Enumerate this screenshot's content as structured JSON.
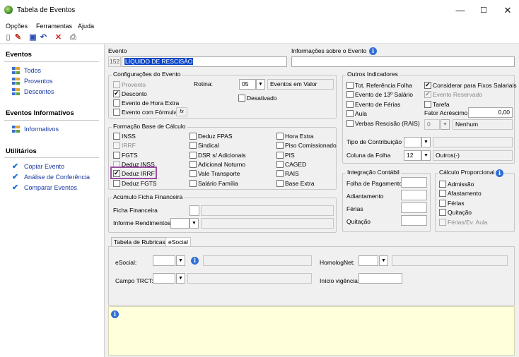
{
  "window": {
    "title": "Tabela de Eventos",
    "min": "—",
    "max": "☐",
    "close": "✕"
  },
  "menu": [
    "Opções",
    "Ferramentas",
    "Ajuda"
  ],
  "sidebar": {
    "sec1": "Eventos",
    "items1": [
      "Todos",
      "Proventos",
      "Descontos"
    ],
    "sec2": "Eventos Informativos",
    "items2": [
      "Informativos"
    ],
    "sec3": "Utilitários",
    "items3": [
      "Copiar Evento",
      "Análise de Conferência",
      "Comparar Eventos"
    ]
  },
  "evento": {
    "label": "Evento",
    "code": "152",
    "name": "LÍQUIDO DE RESCISÃO"
  },
  "info_evento": {
    "label": "Informações sobre o Evento"
  },
  "config": {
    "title": "Configurações do Evento",
    "proventos": "Provento",
    "desconto": "Desconto",
    "hora_extra": "Evento de Hora Extra",
    "formula": "Evento com Fórmula",
    "fx": "fx",
    "rotina_label": "Rotina:",
    "rotina_code": "05",
    "rotina_desc": "Eventos em Valor",
    "desativado": "Desativado"
  },
  "formacao": {
    "title": "Formação Base de Cálculo",
    "col1": [
      "INSS",
      "IRRF",
      "FGTS",
      "Deduz INSS",
      "Deduz IRRF",
      "Deduz FGTS"
    ],
    "col2": [
      "Deduz FPAS",
      "Sindical",
      "DSR s/ Adicionais",
      "Adicional Noturno",
      "Vale Transporte",
      "Salário Família"
    ],
    "col3": [
      "Hora Extra",
      "Piso Comissionado",
      "PIS",
      "CAGED",
      "RAIS",
      "Base Extra"
    ]
  },
  "acumulo": {
    "title": "Acúmulo Ficha Financeira",
    "ficha": "Ficha Financeira",
    "informe": "Informe Rendimentos"
  },
  "outros": {
    "title": "Outros Indicadores",
    "tot_ref": "Tot. Referência Folha",
    "considerar": "Considerar para Fixos Salariais",
    "decimo": "Evento de 13º Salário",
    "reservado": "Evento Reservado",
    "ferias": "Evento de Férias",
    "tarefa": "Tarefa",
    "aula": "Aula",
    "fator_label": "Fator Acréscimo",
    "fator_value": "0,00",
    "verbas": "Verbas Rescisão (RAIS)",
    "verbas_code": "0",
    "verbas_desc": "Nenhum",
    "tipo_contrib": "Tipo de Contribuição",
    "coluna_folha": "Coluna da Folha",
    "coluna_code": "12",
    "coluna_desc": "Outros(-)"
  },
  "integracao": {
    "title": "Integração Contábil",
    "items": [
      "Folha de Pagamento",
      "Adiantamento",
      "Férias",
      "Quitação"
    ]
  },
  "calculo": {
    "title": "Cálculo Proporcional",
    "items": [
      "Admissão",
      "Afastamento",
      "Férias",
      "Quitação",
      "Férias/Ev. Aula"
    ]
  },
  "tabs": [
    "Tabela de Rubricas",
    "eSocial"
  ],
  "esocial": {
    "esocial_label": "eSocial:",
    "homolog_label": "HomologNet:",
    "trct_label": "Campo TRCT:",
    "inicio_label": "Início vigência:"
  },
  "colors": {
    "accent": "#1a3aa0",
    "highlight": "#0a46c8",
    "note_bg": "#ffffdc",
    "mark": "#9b4ea0"
  }
}
